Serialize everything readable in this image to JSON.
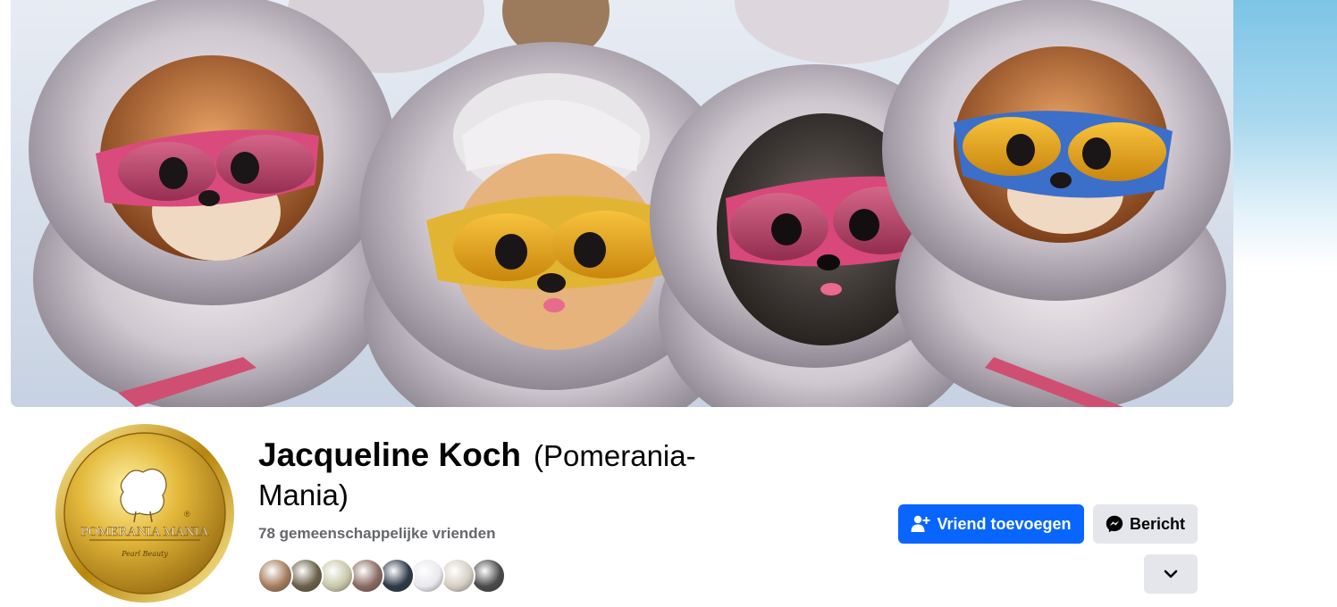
{
  "profile": {
    "name": "Jacqueline Koch",
    "alternate_name_open": "(Pomerania-",
    "alternate_name_close": "Mania)",
    "mutual_friends": "78 gemeenschappelijke vrienden",
    "avatar_logo_text": "POMERANIA MANIA",
    "avatar_logo_sub": "Pearl Beauty"
  },
  "actions": {
    "add_friend": "Vriend toevoegen",
    "message": "Bericht"
  },
  "icons": {
    "add_friend": "person-plus-icon",
    "message": "messenger-icon",
    "more": "chevron-down-icon"
  },
  "colors": {
    "primary_button": "#0866ff",
    "secondary_button": "#e4e6eb",
    "text_primary": "#050505",
    "text_secondary": "#65676b"
  },
  "mutual_friend_avatars": [
    {
      "id": "friend-1",
      "color": "#a57c5c"
    },
    {
      "id": "friend-2",
      "color": "#6b6048"
    },
    {
      "id": "friend-3",
      "color": "#c9c7a8"
    },
    {
      "id": "friend-4",
      "color": "#8a6a62"
    },
    {
      "id": "friend-5",
      "color": "#2d3a48"
    },
    {
      "id": "friend-6",
      "color": "#e8e8ee"
    },
    {
      "id": "friend-7",
      "color": "#d6cec4"
    },
    {
      "id": "friend-8",
      "color": "#4a4a4a"
    }
  ]
}
